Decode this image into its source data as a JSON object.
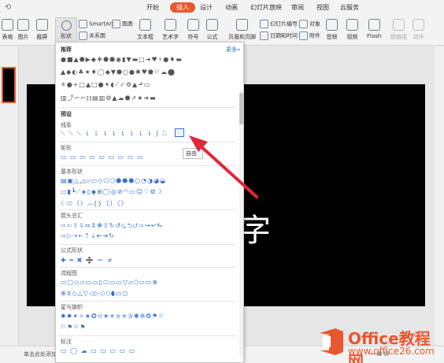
{
  "menubar": {
    "tabs": [
      "开始",
      "插入",
      "设计",
      "动画",
      "幻灯片放映",
      "审阅",
      "视图",
      "云服务"
    ],
    "active_tab": "插入"
  },
  "ribbon": {
    "items": {
      "table": "表格",
      "picture": "图片",
      "screenshot": "截屏",
      "shape": "形状",
      "smartart": "SmartArt",
      "chart": "图表",
      "relation": "关系图",
      "textbox": "文本框",
      "arttext": "艺术字",
      "symbol": "符号",
      "formula": "公式",
      "header_footer": "页眉和页脚",
      "slide_number": "幻灯片编号",
      "object": "对象",
      "datetime": "日期和时间",
      "attachment": "附件",
      "audio": "音频",
      "video": "视频",
      "flash": "Flash",
      "hyperlink": "超链接",
      "action": "动作"
    }
  },
  "shape_dropdown": {
    "recommended": "推荐",
    "more": "更多»",
    "preset": "预设",
    "sections": {
      "lines": "线条",
      "rect": "矩形",
      "basic": "基本形状",
      "arrows": "箭头总汇",
      "formula": "公式形状",
      "flow": "流程图",
      "stars": "星与旗帜",
      "callout": "标注"
    },
    "recommended_rows": [
      "●■▲⬟▶◆❖⬢⬣◉▮▼▬□➜♥⚡●♦▬",
      "▲◆◐♣★♦◯◆▼⬣○●✱♥⬟⚐☁⬤",
      "✳●+□▲□●✦◖⟋✓⚙▲⬏▭",
      "▥⤴⌐⌐⫾⫾▤▥⚙▲☁⬣↗★➜▬"
    ],
    "line_row": "⟍ ⟍ ⟍ ⇂ ⇂ ⇂ ⇂ ⇂ ⇂ ⇂ ⇂ ∫ ⎍",
    "rect_row": "▭ ▭ ▭ ▭ ▭ ▭ ▭ ▭ ▭",
    "basic_rows": [
      "▤▣△◿▱▭◇⬠⬡⬢⬣⬣○◔◑◕◒",
      "▭▮┗⟋◈▯◆⊞◯◎⊘◠▭☺♡⚙☽",
      "☾⬭〈〉⌒{}〔〕〈〉"
    ],
    "arrow_rows": [
      "⇨⇦⇧⇩⇔⇕✥⇳↻↺⮎⮌⮍⇨↪↩⮑",
      "⇨▷⇢⇠⇡⇣⇤⇥↻"
    ],
    "formula_row": "✚ ━ ✖ ➗ ＝ ≠",
    "flow_rows": [
      "▭▢◇▱▭▭▯⬭▭▭▽▱⬯▭▭⊗",
      "⊕⧖◇△▽◁▷⬭⬯⬮▭○"
    ],
    "star_rows": [
      "✹✸✦✧★✪✫✬✭✮✯✰✱✲❂⚑⚐",
      "⚐⚑⚐⚑"
    ],
    "callout_row": "▭ ◯ ☁ ▭ ▭ ▭ ▭ ▭",
    "tooltip": "自由"
  },
  "slide": {
    "text": "字",
    "note": "单击此处添加备注"
  },
  "watermark": {
    "brand": "Office教程网",
    "url": "www.office26.com"
  },
  "colors": {
    "accent": "#e8572f",
    "arrow": "#e0283a",
    "icon_blue": "#3a6fcf"
  }
}
